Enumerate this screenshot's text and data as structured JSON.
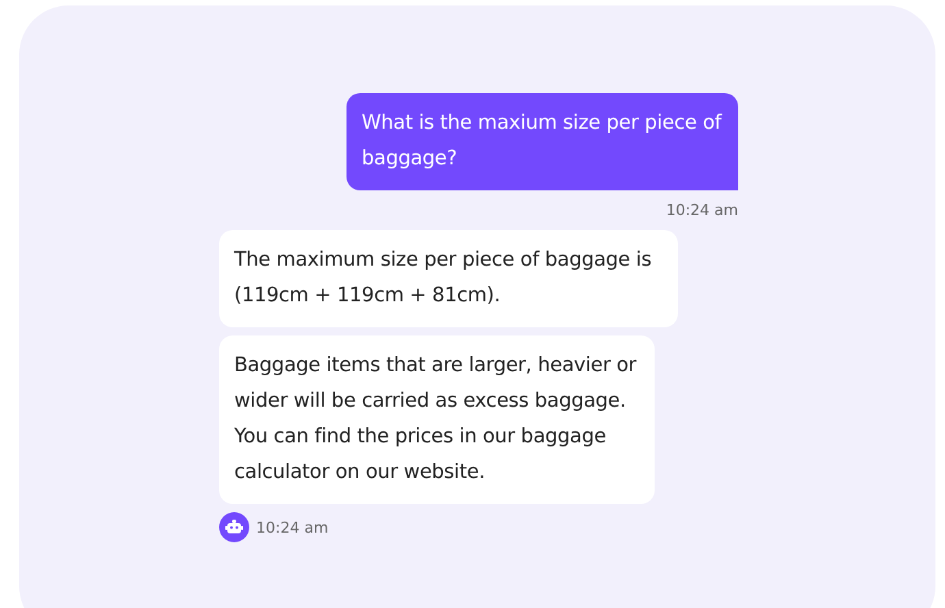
{
  "messages": [
    {
      "kind": "user",
      "text": "What is the maxium size per piece of baggage?",
      "time": "10:24 am"
    },
    {
      "kind": "bot",
      "bubbles": [
        "The maximum size per piece of baggage is (119cm + 119cm + 81cm).",
        "Baggage items that are larger, heavier or wider will be carried as excess baggage. You can find the prices in our baggage calculator on our website."
      ],
      "time": "10:24 am"
    }
  ]
}
